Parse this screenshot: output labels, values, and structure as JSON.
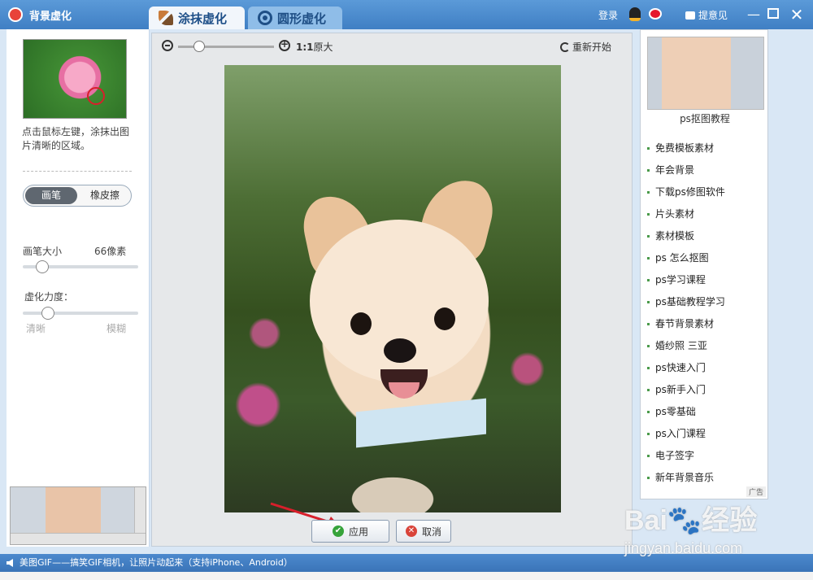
{
  "titlebar": {
    "app_title": "背景虚化",
    "tabs": [
      {
        "label": "涂抹虚化",
        "icon": "smear-brush-icon",
        "active": true
      },
      {
        "label": "圆形虚化",
        "icon": "circle-target-icon",
        "active": false
      }
    ],
    "login_label": "登录",
    "feedback_label": "提意见",
    "minimize_glyph": "—",
    "close_glyph": "✕"
  },
  "left_panel": {
    "hint": "点击鼠标左键，涂抹出图片清晰的区域。",
    "tool_toggle": {
      "brush_label": "画笔",
      "eraser_label": "橡皮擦",
      "selected": "画笔"
    },
    "brush_size": {
      "label": "画笔大小",
      "value_text": "66像素",
      "level": 0.17
    },
    "blur_strength": {
      "label": "虚化力度：",
      "min_label": "清晰",
      "max_label": "模糊",
      "level": 0.22
    }
  },
  "toolbar": {
    "zoom_level": 0.22,
    "actual_size_prefix": "1:1",
    "actual_size_label": "原大",
    "restart_label": "重新开始"
  },
  "actions": {
    "apply_label": "应用",
    "cancel_label": "取消"
  },
  "right_panel": {
    "ad_title": "ps抠图教程",
    "links": [
      "免费模板素材",
      "年会背景",
      "下载ps修图软件",
      "片头素材",
      "素材模板",
      "ps 怎么抠图",
      "ps学习课程",
      "ps基础教程学习",
      "春节背景素材",
      "婚纱照 三亚",
      "ps快速入门",
      "ps新手入门",
      "ps零基础",
      "ps入门课程",
      "电子签字",
      "新年背景音乐"
    ],
    "ad_badge": "广告"
  },
  "statusbar": {
    "message": "美图GIF——搞笑GIF相机，让照片动起来（支持iPhone、Android）"
  },
  "watermark": {
    "brand": "Bai🐾经验",
    "url": "jingyan.baidu.com"
  },
  "colors": {
    "titlebar": "#3f7fc4",
    "apply_icon": "#36a33a",
    "cancel_icon": "#d9443a",
    "arrow": "#d81f2b"
  }
}
